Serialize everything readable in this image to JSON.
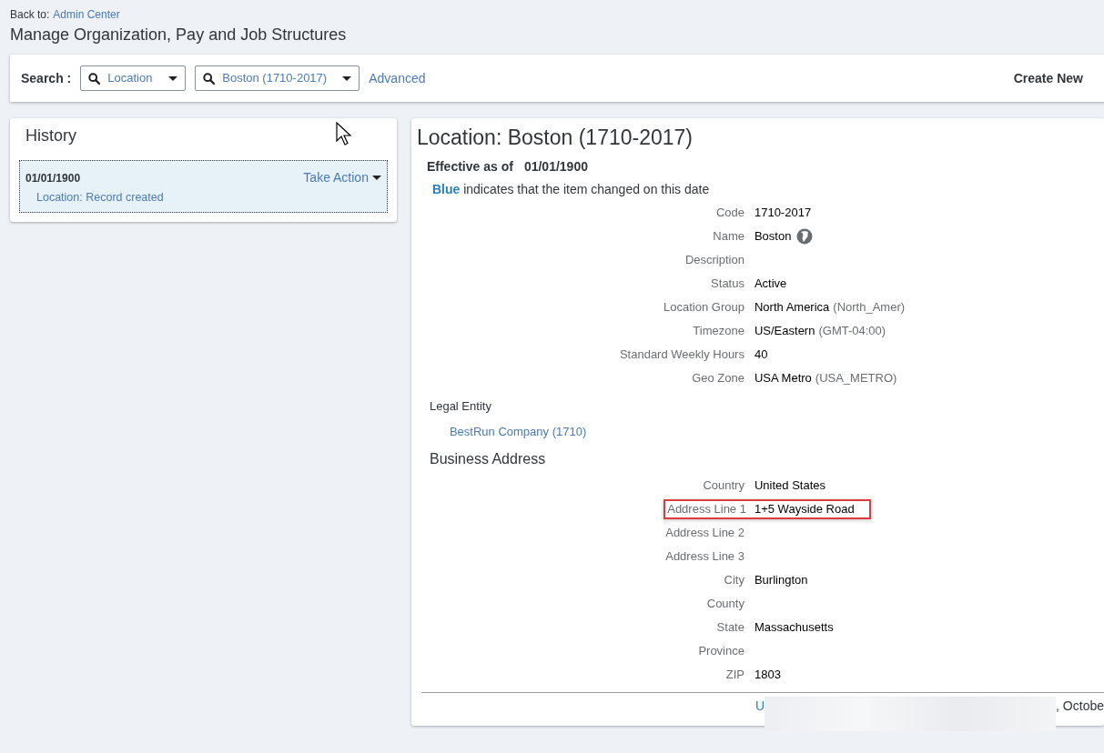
{
  "back_link": {
    "prefix": "Back to:",
    "label": "Admin Center"
  },
  "page_title": "Manage Organization, Pay and Job Structures",
  "search_bar": {
    "label": "Search :",
    "type_select": "Location",
    "record_select": "Boston (1710-2017)",
    "advanced_link": "Advanced",
    "create_new": "Create New"
  },
  "history": {
    "title": "History",
    "entries": [
      {
        "date": "01/01/1900",
        "action": "Take Action",
        "description": "Location: Record created",
        "selected": true
      }
    ]
  },
  "record": {
    "title": "Location: Boston (1710-2017)",
    "effective_label": "Effective as of",
    "effective_date": "01/01/1900",
    "legend": "**Blue** indicates that the item changed on this date",
    "fields": [
      {
        "label": "Code",
        "value": "1710-2017"
      },
      {
        "label": "Name",
        "value": "Boston",
        "kind": "translatable"
      },
      {
        "label": "Description"
      },
      {
        "label": "Status",
        "value": "Active"
      },
      {
        "label": "Location Group",
        "value": "North America",
        "code": "(North_Amer)"
      },
      {
        "label": "Timezone",
        "value": "US/Eastern",
        "code": "(GMT-04:00)"
      },
      {
        "label": "Standard Weekly Hours",
        "value": "40"
      },
      {
        "label": "Geo Zone",
        "value": "USA Metro",
        "code": "(USA_METRO)"
      }
    ],
    "legal_entity": {
      "label": "Legal Entity",
      "value": "BestRun Company (1710)"
    },
    "business_address": {
      "title": "Business Address",
      "fields": [
        {
          "label": "Country",
          "value": "United States",
          "highlighted": false
        },
        {
          "label": "Address Line 1",
          "value": "1+5 Wayside Road",
          "highlighted": true
        },
        {
          "label": "Address Line 2",
          "highlighted": false
        },
        {
          "label": "Address Line 3",
          "highlighted": false
        },
        {
          "label": "City",
          "value": "Burlington",
          "highlighted": false
        },
        {
          "label": "County",
          "highlighted": false
        },
        {
          "label": "State",
          "value": "Massachusetts",
          "highlighted": false
        },
        {
          "label": "Province",
          "highlighted": false
        },
        {
          "label": "ZIP",
          "value": "1803",
          "highlighted": false
        }
      ]
    },
    "footer": {
      "start": "U",
      "end": ", Octobe"
    }
  }
}
